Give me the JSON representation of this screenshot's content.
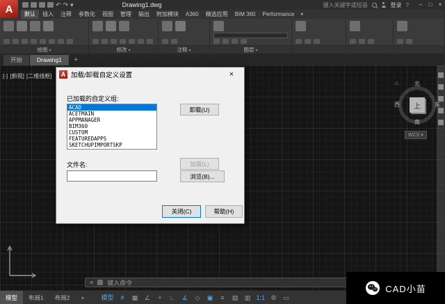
{
  "colors": {
    "selection_blue": "#0078d7",
    "enabled_blue": "#52a7e8",
    "logo_red": "#c0392b"
  },
  "icons": {
    "close": "×",
    "minimize": "–",
    "maximize": "□",
    "help": "?",
    "home": "⌂",
    "dropdown": "▾"
  },
  "titlebar": {
    "logo_letter": "A",
    "quick_access_icons": [
      "new-file-icon",
      "open-file-icon",
      "save-icon",
      "plot-icon",
      "undo-icon",
      "redo-icon",
      "qat-dropdown-icon"
    ],
    "document_title": "Drawing1.dwg",
    "infocenter": {
      "search_text": "键入关键字或短语",
      "signin_label": "登录"
    }
  },
  "ribbon": {
    "tabs": [
      {
        "id": "home",
        "label": "默认",
        "active": true
      },
      {
        "id": "insert",
        "label": "插入"
      },
      {
        "id": "annotate",
        "label": "注释"
      },
      {
        "id": "parametric",
        "label": "参数化"
      },
      {
        "id": "view",
        "label": "视图"
      },
      {
        "id": "manage",
        "label": "管理"
      },
      {
        "id": "output",
        "label": "输出"
      },
      {
        "id": "add-ins",
        "label": "附加模块"
      },
      {
        "id": "a360",
        "label": "A360"
      },
      {
        "id": "featured-apps",
        "label": "精选应用"
      },
      {
        "id": "bim-360",
        "label": "BIM 360"
      },
      {
        "id": "performance",
        "label": "Performance"
      }
    ],
    "panels": [
      {
        "id": "draw",
        "label": "绘图",
        "big_icons": [
          "line-icon",
          "polyline-icon",
          "circle-icon",
          "arc-icon"
        ],
        "small_icons": [
          "rectangle-icon",
          "ellipse-icon",
          "hatch-icon",
          "spline-icon",
          "point-icon",
          "region-icon",
          "gradient-icon",
          "boundary-icon"
        ]
      },
      {
        "id": "modify",
        "label": "修改",
        "big_icons": [
          "move-icon",
          "rotate-icon",
          "trim-icon"
        ],
        "small_icons": [
          "copy-icon",
          "mirror-icon",
          "fillet-icon",
          "array-icon",
          "erase-icon",
          "scale-icon",
          "stretch-icon"
        ]
      },
      {
        "id": "annotation",
        "label": "注释",
        "big_icons": [
          "text-icon",
          "dimension-icon"
        ],
        "small_icons": [
          "leader-icon",
          "table-icon"
        ]
      },
      {
        "id": "layers",
        "label": "图层",
        "layer_dropdown": true,
        "big_icons": [
          "layer-properties-icon"
        ],
        "small_icons": [
          "layer-off-icon",
          "layer-isolate-icon",
          "layer-freeze-icon",
          "layer-lock-icon"
        ]
      },
      {
        "id": "block",
        "label": "",
        "big_icons": [
          "insert-block-icon"
        ],
        "small_icons": [
          "create-block-icon",
          "edit-block-icon",
          "attributes-icon"
        ]
      },
      {
        "id": "properties",
        "label": "",
        "big_icons": [
          "properties-icon"
        ],
        "small_icons": [
          "match-properties-icon",
          "color-icon",
          "linetype-icon"
        ]
      },
      {
        "id": "utilities",
        "label": "",
        "big_icons": [
          "measure-icon"
        ],
        "small_icons": [
          "paste-icon",
          "copy-clip-icon"
        ]
      }
    ]
  },
  "file_tabs": {
    "tabs": [
      {
        "id": "start",
        "label": "开始"
      },
      {
        "id": "drawing1",
        "label": "Drawing1",
        "active": true
      }
    ],
    "new_tab_label": "+"
  },
  "viewport": {
    "controls": [
      "[-]",
      "[俯视]",
      "[二维线框]"
    ]
  },
  "dialog": {
    "title": "加载/卸载自定义设置",
    "groups_label": "已加载的自定义组:",
    "groups": [
      "ACAD",
      "ACETMAIN",
      "APPMANAGER",
      "BIM360",
      "CUSTOM",
      "FEATUREDAPPS",
      "SKETCHUPIMPORTSKP"
    ],
    "selected_group": "ACAD",
    "filename_label": "文件名:",
    "filename_value": "",
    "buttons": {
      "unload": "卸载(U)",
      "load": "加载(L)",
      "browse": "浏览(B)...",
      "close": "关闭(C)",
      "help": "帮助(H)"
    }
  },
  "viewcube": {
    "north": "北",
    "south": "南",
    "west": "西",
    "east": "东",
    "top_face": "上",
    "coordinate_system": "WCS"
  },
  "navbar": {
    "icons": [
      "navigation-wheel-icon",
      "pan-icon",
      "zoom-icon",
      "orbit-icon",
      "showmotion-icon"
    ]
  },
  "command_line": {
    "prompt": "键入命令"
  },
  "statusbar": {
    "layout_tabs": [
      {
        "id": "model",
        "label": "模型",
        "active": true
      },
      {
        "id": "layout1",
        "label": "布局1"
      },
      {
        "id": "layout2",
        "label": "布局2"
      },
      {
        "id": "new-layout",
        "label": "+"
      }
    ],
    "icons": [
      {
        "id": "model-space",
        "glyph": "模型",
        "on": true
      },
      {
        "id": "grid",
        "glyph": "#",
        "on": true
      },
      {
        "id": "snap-mode",
        "glyph": "▦",
        "on": false
      },
      {
        "id": "infer-constraints",
        "glyph": "∠",
        "on": false
      },
      {
        "id": "dynamic-input",
        "glyph": "+",
        "on": true
      },
      {
        "id": "ortho",
        "glyph": "∟",
        "on": false
      },
      {
        "id": "polar-tracking",
        "glyph": "∡",
        "on": true
      },
      {
        "id": "isodraft",
        "glyph": "◇",
        "on": false
      },
      {
        "id": "object-snap",
        "glyph": "▣",
        "on": true
      },
      {
        "id": "lineweight",
        "glyph": "≡",
        "on": false
      },
      {
        "id": "transparency",
        "glyph": "▨",
        "on": false
      },
      {
        "id": "selection-cycling",
        "glyph": "▥",
        "on": false
      },
      {
        "id": "annotation-scale",
        "glyph": "1:1",
        "on": true
      },
      {
        "id": "workspace",
        "glyph": "⚙",
        "on": false
      },
      {
        "id": "clean-screen",
        "glyph": "▭",
        "on": false
      }
    ]
  },
  "watermark": {
    "text": "CAD小苗"
  }
}
